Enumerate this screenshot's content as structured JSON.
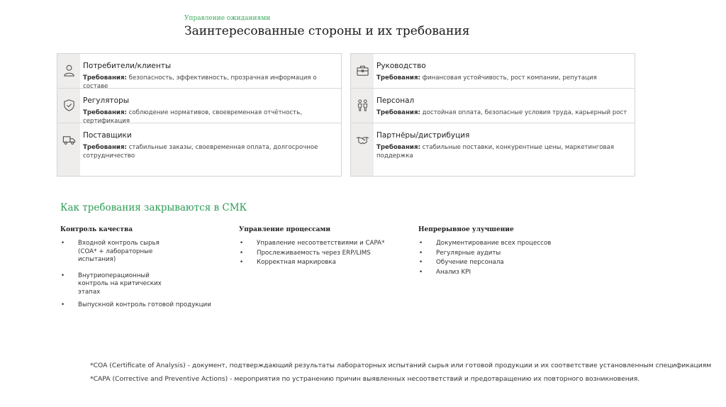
{
  "header": {
    "kicker": "Управление ожиданиями",
    "title": "Заинтересованные стороны и их требования"
  },
  "req_label": "Требования:",
  "stakeholders_left": [
    {
      "name": "Потребители/клиенты",
      "requirements": "безопасность, эффективность, прозрачная информация о составе",
      "icon": "person-icon"
    },
    {
      "name": "Регуляторы",
      "requirements": "соблюдение нормативов, своевременная отчётность, сертификация",
      "icon": "shield-check-icon"
    },
    {
      "name": "Поставщики",
      "requirements": "стабильные заказы, своевременная оплата, долгосрочное сотрудничество",
      "icon": "truck-icon"
    }
  ],
  "stakeholders_right": [
    {
      "name": "Руководство",
      "requirements": "финансовая устойчивость, рост компании, репутация",
      "icon": "briefcase-icon"
    },
    {
      "name": "Персонал",
      "requirements": "достойная оплата, безопасные условия труда, карьерный рост",
      "icon": "people-icon"
    },
    {
      "name": "Партнёры/дистрибуция",
      "requirements": "стабильные поставки, конкурентные цены, маркетинговая поддержка",
      "icon": "handshake-icon"
    }
  ],
  "section": {
    "title": "Как требования закрываются в СМК",
    "columns": [
      {
        "heading": "Контроль качества",
        "items": [
          "Входной контроль сырья (COA* + лабораторные испытания)",
          "Внутриоперационный контроль на критических этапах",
          "Выпускной контроль готовой продукции"
        ]
      },
      {
        "heading": "Управление процессами",
        "items": [
          "Управление несоответствиями и CAPA*",
          "Прослеживаемость через ERP/LIMS",
          "Корректная маркировка"
        ]
      },
      {
        "heading": "Непрерывное улучшение",
        "items": [
          "Документирование всех процессов",
          "Регулярные аудиты",
          "Обучение персонала",
          "Анализ KPI"
        ]
      }
    ]
  },
  "footnotes": [
    "*COA (Certificate of Analysis) - документ, подтверждающий результаты лабораторных испытаний сырья или готовой продукции и их соответствие установленным спецификациям",
    "*CAPA (Corrective and Preventive Actions) -  мероприятия по устранению причин выявленных несоответствий и предотвращению их повторного возникновения."
  ]
}
